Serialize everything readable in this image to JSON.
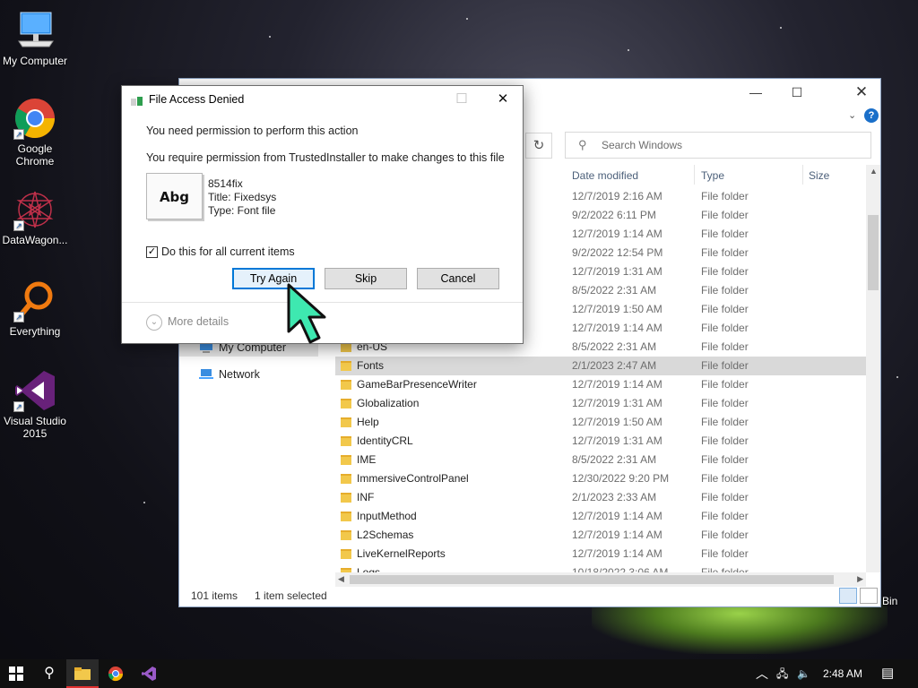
{
  "desktop": {
    "icons": [
      {
        "label": "My Computer",
        "icon": "monitor-icon"
      },
      {
        "label": "Google Chrome",
        "icon": "chrome-icon"
      },
      {
        "label": "DataWagon...",
        "icon": "datawagon-icon"
      },
      {
        "label": "Everything",
        "icon": "everything-search-icon"
      },
      {
        "label": "Visual Studio 2015",
        "icon": "visual-studio-icon"
      }
    ],
    "recycle_bin_partial_label": "Bin"
  },
  "explorer": {
    "search_placeholder": "Search Windows",
    "columns": {
      "date": "Date modified",
      "type": "Type",
      "size": "Size"
    },
    "nav": [
      {
        "label": "My Computer",
        "icon": "monitor-icon",
        "active": true
      },
      {
        "label": "Network",
        "icon": "network-icon",
        "active": false
      }
    ],
    "rows": [
      {
        "name": "",
        "date": "12/7/2019 2:16 AM",
        "type": "File folder"
      },
      {
        "name": "",
        "date": "9/2/2022 6:11 PM",
        "type": "File folder"
      },
      {
        "name": "",
        "date": "12/7/2019 1:14 AM",
        "type": "File folder"
      },
      {
        "name": "",
        "date": "9/2/2022 12:54 PM",
        "type": "File folder"
      },
      {
        "name": "",
        "date": "12/7/2019 1:31 AM",
        "type": "File folder"
      },
      {
        "name": "",
        "date": "8/5/2022 2:31 AM",
        "type": "File folder"
      },
      {
        "name": "",
        "date": "12/7/2019 1:50 AM",
        "type": "File folder"
      },
      {
        "name": "",
        "date": "12/7/2019 1:14 AM",
        "type": "File folder"
      },
      {
        "name": "en-US",
        "date": "8/5/2022 2:31 AM",
        "type": "File folder"
      },
      {
        "name": "Fonts",
        "date": "2/1/2023 2:47 AM",
        "type": "File folder",
        "selected": true
      },
      {
        "name": "GameBarPresenceWriter",
        "date": "12/7/2019 1:14 AM",
        "type": "File folder"
      },
      {
        "name": "Globalization",
        "date": "12/7/2019 1:31 AM",
        "type": "File folder"
      },
      {
        "name": "Help",
        "date": "12/7/2019 1:50 AM",
        "type": "File folder"
      },
      {
        "name": "IdentityCRL",
        "date": "12/7/2019 1:31 AM",
        "type": "File folder"
      },
      {
        "name": "IME",
        "date": "8/5/2022 2:31 AM",
        "type": "File folder"
      },
      {
        "name": "ImmersiveControlPanel",
        "date": "12/30/2022 9:20 PM",
        "type": "File folder"
      },
      {
        "name": "INF",
        "date": "2/1/2023 2:33 AM",
        "type": "File folder"
      },
      {
        "name": "InputMethod",
        "date": "12/7/2019 1:14 AM",
        "type": "File folder"
      },
      {
        "name": "L2Schemas",
        "date": "12/7/2019 1:14 AM",
        "type": "File folder"
      },
      {
        "name": "LiveKernelReports",
        "date": "12/7/2019 1:14 AM",
        "type": "File folder"
      },
      {
        "name": "Logs",
        "date": "10/18/2022 3:06 AM",
        "type": "File folder"
      }
    ],
    "status": {
      "items": "101 items",
      "selected": "1 item selected"
    }
  },
  "dialog": {
    "title": "File Access Denied",
    "message1": "You need permission to perform this action",
    "message2": "You require permission from TrustedInstaller to make changes to this file",
    "thumb_text": "Abg",
    "file_name": "8514fix",
    "file_title": "Title: Fixedsys",
    "file_type": "Type: Font file",
    "checkbox_label": "Do this for all current items",
    "checkbox_checked": true,
    "buttons": {
      "try_again": "Try Again",
      "skip": "Skip",
      "cancel": "Cancel"
    },
    "more_details": "More details"
  },
  "taskbar": {
    "clock": "2:48 AM",
    "pinned": [
      "windows-start-icon",
      "search-icon",
      "file-explorer-icon",
      "chrome-icon",
      "visual-studio-icon"
    ]
  },
  "colors": {
    "accent": "#0078d7",
    "cursor": "#3ee8b0",
    "folder": "#f2c84b"
  }
}
